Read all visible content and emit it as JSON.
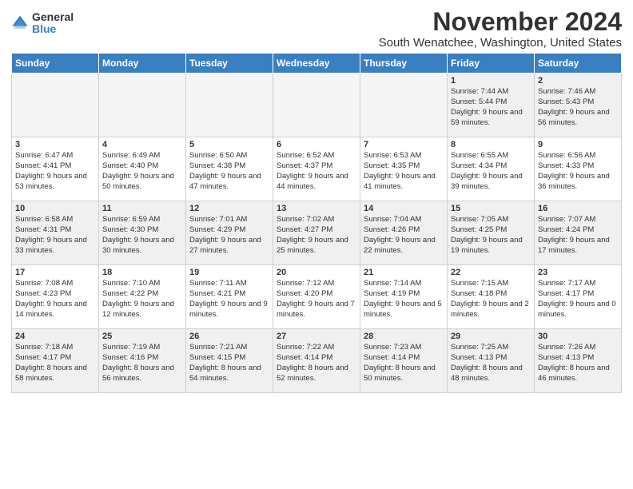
{
  "logo": {
    "general": "General",
    "blue": "Blue"
  },
  "title": "November 2024",
  "location": "South Wenatchee, Washington, United States",
  "days_of_week": [
    "Sunday",
    "Monday",
    "Tuesday",
    "Wednesday",
    "Thursday",
    "Friday",
    "Saturday"
  ],
  "weeks": [
    [
      {
        "day": "",
        "empty": true
      },
      {
        "day": "",
        "empty": true
      },
      {
        "day": "",
        "empty": true
      },
      {
        "day": "",
        "empty": true
      },
      {
        "day": "",
        "empty": true
      },
      {
        "day": "1",
        "sunrise": "Sunrise: 7:44 AM",
        "sunset": "Sunset: 5:44 PM",
        "daylight": "Daylight: 9 hours and 59 minutes."
      },
      {
        "day": "2",
        "sunrise": "Sunrise: 7:46 AM",
        "sunset": "Sunset: 5:43 PM",
        "daylight": "Daylight: 9 hours and 56 minutes."
      }
    ],
    [
      {
        "day": "3",
        "sunrise": "Sunrise: 6:47 AM",
        "sunset": "Sunset: 4:41 PM",
        "daylight": "Daylight: 9 hours and 53 minutes."
      },
      {
        "day": "4",
        "sunrise": "Sunrise: 6:49 AM",
        "sunset": "Sunset: 4:40 PM",
        "daylight": "Daylight: 9 hours and 50 minutes."
      },
      {
        "day": "5",
        "sunrise": "Sunrise: 6:50 AM",
        "sunset": "Sunset: 4:38 PM",
        "daylight": "Daylight: 9 hours and 47 minutes."
      },
      {
        "day": "6",
        "sunrise": "Sunrise: 6:52 AM",
        "sunset": "Sunset: 4:37 PM",
        "daylight": "Daylight: 9 hours and 44 minutes."
      },
      {
        "day": "7",
        "sunrise": "Sunrise: 6:53 AM",
        "sunset": "Sunset: 4:35 PM",
        "daylight": "Daylight: 9 hours and 41 minutes."
      },
      {
        "day": "8",
        "sunrise": "Sunrise: 6:55 AM",
        "sunset": "Sunset: 4:34 PM",
        "daylight": "Daylight: 9 hours and 39 minutes."
      },
      {
        "day": "9",
        "sunrise": "Sunrise: 6:56 AM",
        "sunset": "Sunset: 4:33 PM",
        "daylight": "Daylight: 9 hours and 36 minutes."
      }
    ],
    [
      {
        "day": "10",
        "sunrise": "Sunrise: 6:58 AM",
        "sunset": "Sunset: 4:31 PM",
        "daylight": "Daylight: 9 hours and 33 minutes."
      },
      {
        "day": "11",
        "sunrise": "Sunrise: 6:59 AM",
        "sunset": "Sunset: 4:30 PM",
        "daylight": "Daylight: 9 hours and 30 minutes."
      },
      {
        "day": "12",
        "sunrise": "Sunrise: 7:01 AM",
        "sunset": "Sunset: 4:29 PM",
        "daylight": "Daylight: 9 hours and 27 minutes."
      },
      {
        "day": "13",
        "sunrise": "Sunrise: 7:02 AM",
        "sunset": "Sunset: 4:27 PM",
        "daylight": "Daylight: 9 hours and 25 minutes."
      },
      {
        "day": "14",
        "sunrise": "Sunrise: 7:04 AM",
        "sunset": "Sunset: 4:26 PM",
        "daylight": "Daylight: 9 hours and 22 minutes."
      },
      {
        "day": "15",
        "sunrise": "Sunrise: 7:05 AM",
        "sunset": "Sunset: 4:25 PM",
        "daylight": "Daylight: 9 hours and 19 minutes."
      },
      {
        "day": "16",
        "sunrise": "Sunrise: 7:07 AM",
        "sunset": "Sunset: 4:24 PM",
        "daylight": "Daylight: 9 hours and 17 minutes."
      }
    ],
    [
      {
        "day": "17",
        "sunrise": "Sunrise: 7:08 AM",
        "sunset": "Sunset: 4:23 PM",
        "daylight": "Daylight: 9 hours and 14 minutes."
      },
      {
        "day": "18",
        "sunrise": "Sunrise: 7:10 AM",
        "sunset": "Sunset: 4:22 PM",
        "daylight": "Daylight: 9 hours and 12 minutes."
      },
      {
        "day": "19",
        "sunrise": "Sunrise: 7:11 AM",
        "sunset": "Sunset: 4:21 PM",
        "daylight": "Daylight: 9 hours and 9 minutes."
      },
      {
        "day": "20",
        "sunrise": "Sunrise: 7:12 AM",
        "sunset": "Sunset: 4:20 PM",
        "daylight": "Daylight: 9 hours and 7 minutes."
      },
      {
        "day": "21",
        "sunrise": "Sunrise: 7:14 AM",
        "sunset": "Sunset: 4:19 PM",
        "daylight": "Daylight: 9 hours and 5 minutes."
      },
      {
        "day": "22",
        "sunrise": "Sunrise: 7:15 AM",
        "sunset": "Sunset: 4:18 PM",
        "daylight": "Daylight: 9 hours and 2 minutes."
      },
      {
        "day": "23",
        "sunrise": "Sunrise: 7:17 AM",
        "sunset": "Sunset: 4:17 PM",
        "daylight": "Daylight: 9 hours and 0 minutes."
      }
    ],
    [
      {
        "day": "24",
        "sunrise": "Sunrise: 7:18 AM",
        "sunset": "Sunset: 4:17 PM",
        "daylight": "Daylight: 8 hours and 58 minutes."
      },
      {
        "day": "25",
        "sunrise": "Sunrise: 7:19 AM",
        "sunset": "Sunset: 4:16 PM",
        "daylight": "Daylight: 8 hours and 56 minutes."
      },
      {
        "day": "26",
        "sunrise": "Sunrise: 7:21 AM",
        "sunset": "Sunset: 4:15 PM",
        "daylight": "Daylight: 8 hours and 54 minutes."
      },
      {
        "day": "27",
        "sunrise": "Sunrise: 7:22 AM",
        "sunset": "Sunset: 4:14 PM",
        "daylight": "Daylight: 8 hours and 52 minutes."
      },
      {
        "day": "28",
        "sunrise": "Sunrise: 7:23 AM",
        "sunset": "Sunset: 4:14 PM",
        "daylight": "Daylight: 8 hours and 50 minutes."
      },
      {
        "day": "29",
        "sunrise": "Sunrise: 7:25 AM",
        "sunset": "Sunset: 4:13 PM",
        "daylight": "Daylight: 8 hours and 48 minutes."
      },
      {
        "day": "30",
        "sunrise": "Sunrise: 7:26 AM",
        "sunset": "Sunset: 4:13 PM",
        "daylight": "Daylight: 8 hours and 46 minutes."
      }
    ]
  ]
}
